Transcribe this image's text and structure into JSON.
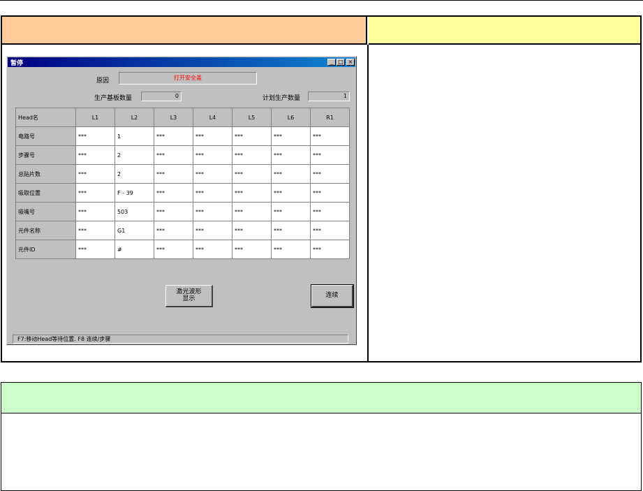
{
  "dialog": {
    "title": "暂停",
    "minimize_icon": "_",
    "maximize_icon": "□",
    "close_icon": "×",
    "reason_label": "原因",
    "reason_value": "打开安全盖",
    "boards_label": "生产基板数量",
    "boards_value": "0",
    "plan_label": "计划生产数量",
    "plan_value": "1",
    "table": {
      "corner": "Head名",
      "columns": [
        "L1",
        "L2",
        "L3",
        "L4",
        "L5",
        "L6",
        "R1"
      ],
      "rows": [
        {
          "label": "电路号",
          "cells": [
            "***",
            "1",
            "***",
            "***",
            "***",
            "***",
            "***"
          ]
        },
        {
          "label": "步骤号",
          "cells": [
            "***",
            "2",
            "***",
            "***",
            "***",
            "***",
            "***"
          ]
        },
        {
          "label": "总贴片数",
          "cells": [
            "***",
            "2",
            "***",
            "***",
            "***",
            "***",
            "***"
          ]
        },
        {
          "label": "吸取位置",
          "cells": [
            "***",
            "F - 39",
            "***",
            "***",
            "***",
            "***",
            "***"
          ]
        },
        {
          "label": "吸嘴号",
          "cells": [
            "***",
            "503",
            "***",
            "***",
            "***",
            "***",
            "***"
          ]
        },
        {
          "label": "元件名称",
          "cells": [
            "***",
            "G1",
            "***",
            "***",
            "***",
            "***",
            "***"
          ]
        },
        {
          "label": "元件ID",
          "cells": [
            "***",
            "#",
            "***",
            "***",
            "***",
            "***",
            "***"
          ]
        }
      ]
    },
    "wave_button": "激光波形显示",
    "continue_button": "连续",
    "status_bar": "F7:移动Head等待位置.   F8 连续/步骤"
  }
}
